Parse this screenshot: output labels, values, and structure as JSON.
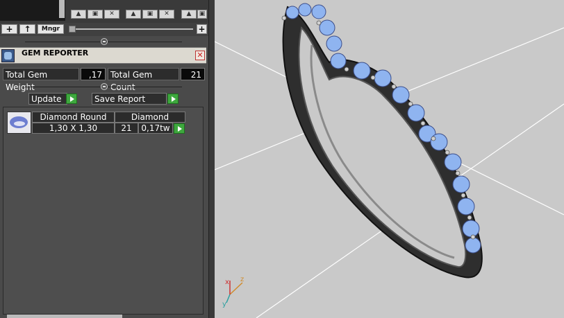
{
  "toolbar": {
    "add_label": "+",
    "up_label": "↑",
    "manager_label": "Mngr",
    "plus_right": "+"
  },
  "gem_reporter": {
    "title": "GEM REPORTER",
    "total_weight_label": "Total Gem Weight",
    "total_weight_value": ",17",
    "total_count_label": "Total Gem Count",
    "total_count_value": "21",
    "update_label": "Update",
    "save_report_label": "Save Report",
    "columns": [
      "Diamond Round",
      "Diamond"
    ],
    "rows": [
      {
        "size": "1,30 X 1,30",
        "count": "21",
        "weight": "0,17tw"
      }
    ]
  },
  "viewport": {
    "axis_labels": {
      "x": "x",
      "y": "y",
      "z": "z"
    },
    "colors": {
      "background": "#c9c9c9",
      "metal": "#3a3a3a",
      "gem": "#8fb4f0"
    }
  }
}
